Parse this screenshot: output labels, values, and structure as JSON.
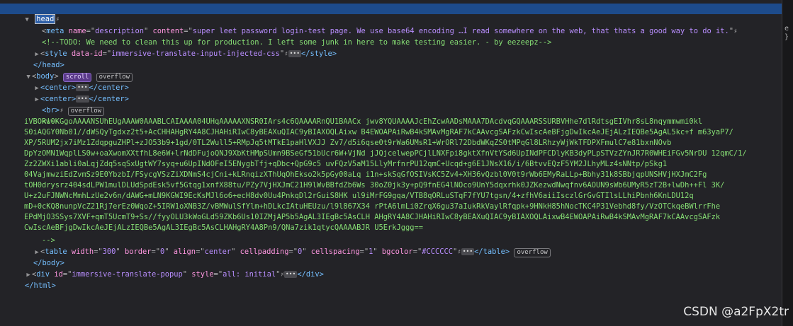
{
  "lines": {
    "head_open": "head",
    "meta": {
      "tag": "meta",
      "name_attr": "name",
      "name_val": "description",
      "content_attr": "content",
      "content_val": "super leet password login-test page. We use base64 encoding …I read somewhere on the web, that thats a good way to do it."
    },
    "todo_comment": "<!--TODO: We need to clean this up for production. I left some junk in here to make testing easier. - by eezeepz-->",
    "style": {
      "tag": "style",
      "attr": "data-id",
      "val": "immersive-translate-input-injected-css",
      "close": "</style>"
    },
    "head_close": "</head>",
    "body": {
      "tag": "body",
      "badge_scroll": "scroll",
      "badge_overflow": "overflow"
    },
    "center1": {
      "open": "<center>",
      "close": "</center>"
    },
    "center2": {
      "open": "<center>",
      "close": "</center>"
    },
    "br": {
      "tag": "<br>",
      "badge": "overflow"
    },
    "comment_open": "<!--",
    "base64": [
      "iVBORw0KGgoAAAANSUhEUgAAAW0AAABLCAIAAAA04UHqAAAAAXNSR0IArs4c6QAAAARnQU1BAACx jwv8YQUAAAAJcEhZcwAADsMAAA7DAcdvqGQAAARSSURBVHhe7dlRdtsgEIVhr8sL8nqymmwmi0kl",
      "S0iAQGY0Nb01//dWSQyTgdxz2t5+AcCHHAHgRY4A8CJHAHiRIwC8yBEAXuQIAC9yBIAXOQLAixw B4EWOAPAiRwB4kSMAvMgRAF7kCAAvcgSAFzkCwIscAeBFjgDwIkcAeJEjALzIEQBe5AgAL5kc+f m63yaP7/",
      "XP/5RUM2jx7iMz1ZdqpguZHPl+zJO53b9+1gd/0TL2Wull5+RMpJq5tMTkE1paHlVXJJ Zv7/d5i6qse0t9rWa6UMsR1+WrORl72DbdWKqZS0tMPqGl8LRhzyWjWkTFDPXFmulC7e81bxnNOvb",
      "DpYzOMN1WqplLS0w+oaXwomXXtfhL8e6W+lrNdDFujoQNJ9XbKtHMpSUmn9BSeGf51bUcr6W+VjNd jJQjcelwepPCjlLNXFpi8gktXfnVtYSd6UpINdPFCDlyKB3dyPLpSTVzZYnJR7R0WHEiFGv5NrDU 12qmC/1/",
      "Zz2ZWXi1abli0aLqjZdq5sqSxUgtWY7syq+u6UpINdOFeI5ENygbTfj+qDbc+QpG9c5 uvFQzV5aM15LlyMrfnrPU12qmC+Ucqd+g6E1JNsX16/i/6BtvvEQzF5YM2JLhyMLz4sNNtp/pSkg1",
      "04VajmwziEdZvmSz9E0YbzbI/FSycgVSzZiXDNmS4cjCni+kLRnqizXThUqOhEkso2k5pGy00aLq i1n+skSqGfOSIVsKC5Zv4+XH36vQzbl0V0t9rWb6EMyRaLLp+Bbhy31k8SBbjqpUNSHVjHXJmC2Fg",
      "tOH0drysrz404sdLPW1mulDLUdSpdEsk5vf5Gtqg1xnfX88tu/PZy7VjHXJmC21H9lWvBBfdZb6Ws 30oZ0jk3y+pQ9fnEG4lNOco9UnY5dqxrhk0JZKezwdNwqfnv6AOUN9sWb6UMyR5zT2B+lwDh++Fl 3K/",
      "U+z2uFJNWNcMmhLzUe2v6n/dAWG+mLN9KGWI9EcKsMJl6o6+ecH8dv0Uu4PnkqDl2rGuiS8HK ul9iMrFG9gqa/VTB8qORLuSTqF7fYU7tgsn/4+zfhV6aiiIsczlGrGvGTIlsLLhiPbnh6KnLDU12q",
      "mD+0cKQ8nunpVcZ21Rj7erEz0WqoZ+5IRW1oXNB3Z/vBMWulSfYlm+hDLkcIAtuHEUzu/l9l867X34 rPtA6lmLi0ZrqX6gu37aIukRkVaylRfqpk+9HNkH85hNocTKC4P31Vebhd8fy/VzOTCkqeBWlrrFhe",
      "EPdMjO3SSys7XVF+qmT5UcmT9+Ss//fyyOLU3kWoGLd59ZKb6Us10IZMjAP5b5AgAL3IEgBc5AsCLH AHgRY4A8CJHAHiRIwC8yBEAXuQIAC9yBIAXOQLAixwB4EWOAPAiRwB4kSMAvMgRAF7kCAAvcgSAFzk",
      "CwIscAeBFjgDwIkcAeJEjALzIEQBe5AgAL3IEgBc5AsCLHAHgRY4A8Pn9/QNa7zik1qtycQAAAABJR U5ErkJggg=="
    ],
    "comment_close": "-->",
    "table": {
      "tag": "table",
      "a1": "width",
      "v1": "300",
      "a2": "border",
      "v2": "0",
      "a3": "align",
      "v3": "center",
      "a4": "cellpadding",
      "v4": "0",
      "a5": "cellspacing",
      "v5": "1",
      "a6": "bgcolor",
      "v6": "#CCCCCC",
      "close": "</table>",
      "badge": "overflow"
    },
    "body_close": "</body>",
    "div": {
      "tag": "div",
      "a1": "id",
      "v1": "immersive-translate-popup",
      "a2": "style",
      "v2": "all: initial",
      "close": "</div>"
    },
    "html_close": "</html>"
  },
  "side_panel": {
    "text1": "e",
    "text2": "}"
  },
  "watermark": "CSDN @a2FpX2tr",
  "colors": {
    "background": "#232327",
    "selection": "#1d4b8b",
    "tag": "#75bfff",
    "attribute": "#ff97e1",
    "value": "#b98eff",
    "comment": "#86de74"
  }
}
